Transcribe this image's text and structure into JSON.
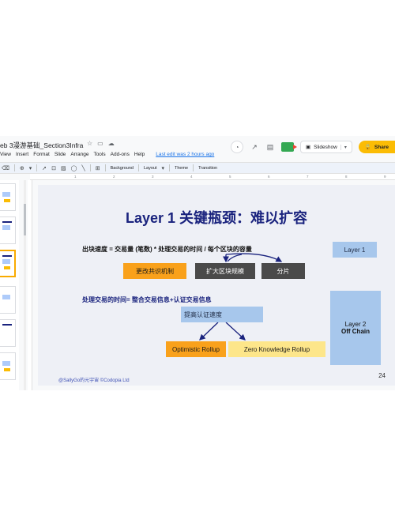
{
  "window": {
    "doc_title": "eb 3漫游基础_Section3Infra",
    "title_icons": [
      "star-icon",
      "folder-icon",
      "cloud-icon"
    ]
  },
  "menu": {
    "items": [
      "View",
      "Insert",
      "Format",
      "Slide",
      "Arrange",
      "Tools",
      "Add-ons",
      "Help"
    ],
    "last_edit": "Last edit was 2 hours ago"
  },
  "actions": {
    "slideshow_label": "Slideshow",
    "share_label": "Share"
  },
  "toolbar": {
    "background_label": "Background",
    "layout_label": "Layout",
    "theme_label": "Theme",
    "transition_label": "Transition"
  },
  "ruler": {
    "ticks": [
      "1",
      "2",
      "3",
      "4",
      "5",
      "6",
      "7",
      "8",
      "9"
    ]
  },
  "filmstrip": {
    "slide_numbers": [
      "",
      "",
      "",
      "",
      "",
      ""
    ]
  },
  "slide": {
    "title": "Layer 1 关键瓶颈：难以扩容",
    "formula": "出块速度  = 交易量 (笔数) * 处理交易的时间 / 每个区块的容量",
    "layer1_label": "Layer 1",
    "consensus_label": "更改共识机制",
    "block_size_label": "扩大区块规模",
    "sharding_label": "分片",
    "heading2": "处理交易的时间= 整合交易信息+认证交易信息",
    "verify_speed_label": "提高认证速度",
    "optimistic_label": "Optimistic Rollup",
    "zk_label": "Zero Knowledge Rollup",
    "layer2_line1": "Layer 2",
    "layer2_line2": "Off Chain",
    "credit": "@SallyGo的元宇宙 ©Codopia Ltd",
    "page_number": "24"
  },
  "colors": {
    "title_blue": "#1a237e",
    "light_blue_box": "#a7c7ec",
    "orange_box": "#f9a11b",
    "dark_box": "#4a4a4a",
    "yellow_box": "#fde68a",
    "share_yellow": "#fbbc04",
    "slide_bg": "#eef0f6"
  }
}
